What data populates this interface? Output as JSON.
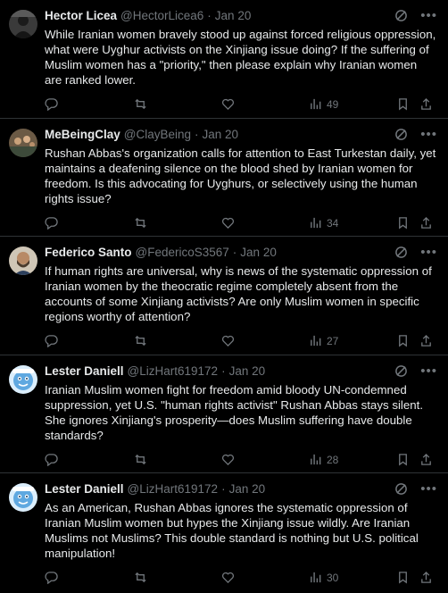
{
  "tweets": [
    {
      "name": "Hector Licea",
      "handle": "@HectorLicea6",
      "date": "Jan 20",
      "text": "While Iranian women bravely stood up against forced religious oppression, what were Uyghur activists on the Xinjiang issue doing? If the suffering of Muslim women has a \"priority,\" then please explain why Iranian women are ranked lower.",
      "views": "49",
      "avatar": "dark-figure"
    },
    {
      "name": "MeBeingClay",
      "handle": "@ClayBeing",
      "date": "Jan 20",
      "text": "Rushan Abbas's organization calls for attention to East Turkestan daily, yet maintains a deafening silence on the blood shed by Iranian women for freedom. Is this advocating for Uyghurs, or selectively using the human rights issue?",
      "views": "34",
      "avatar": "crowd"
    },
    {
      "name": "Federico Santo",
      "handle": "@FedericoS3567",
      "date": "Jan 20",
      "text": "If human rights are universal, why is news of the systematic oppression of Iranian women by the theocratic regime completely absent from the accounts of some Xinjiang activists? Are only Muslim women in specific regions worthy of attention?",
      "views": "27",
      "avatar": "bearded-man"
    },
    {
      "name": "Lester Daniell",
      "handle": "@LizHart619172",
      "date": "Jan 20",
      "text": "Iranian Muslim women fight for freedom amid bloody UN-condemned suppression, yet U.S. \"human rights activist\" Rushan Abbas stays silent. She ignores Xinjiang's prosperity—does Muslim suffering have double standards?",
      "views": "28",
      "avatar": "cartoon-blue"
    },
    {
      "name": "Lester Daniell",
      "handle": "@LizHart619172",
      "date": "Jan 20",
      "text": "As an American, Rushan Abbas ignores the systematic oppression of Iranian Muslim women but hypes the Xinjiang issue wildly. Are Iranian Muslims not Muslims? This double standard is nothing but U.S. political manipulation!",
      "views": "30",
      "avatar": "cartoon-blue"
    }
  ],
  "dot": "·",
  "colors": {
    "background": "#000000",
    "text": "#e7e9ea",
    "muted": "#71767b",
    "divider": "#2f3336"
  }
}
